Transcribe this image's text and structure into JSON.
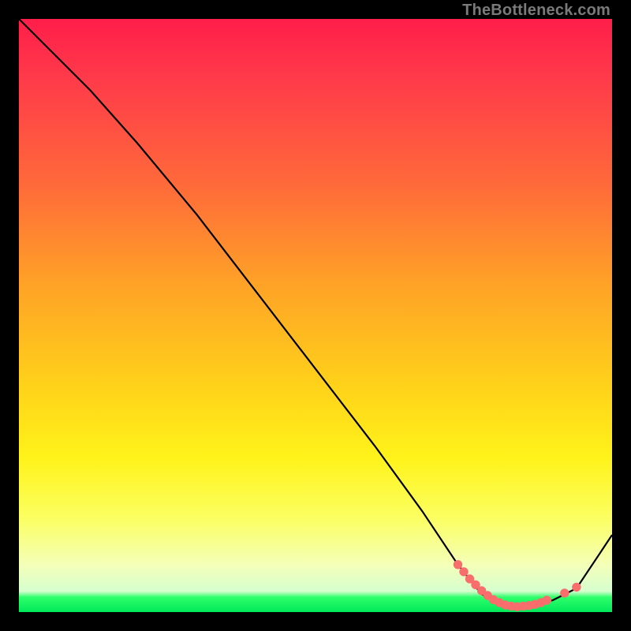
{
  "attribution": "TheBottleneck.com",
  "colors": {
    "curve_stroke": "#000000",
    "dot_fill": "#f96d6d",
    "dot_stroke": "#f96d6d"
  },
  "chart_data": {
    "type": "line",
    "title": "",
    "xlabel": "",
    "ylabel": "",
    "xlim": [
      0,
      100
    ],
    "ylim": [
      0,
      100
    ],
    "series": [
      {
        "name": "curve",
        "x": [
          0,
          6,
          12,
          20,
          30,
          40,
          50,
          60,
          68,
          74,
          78,
          82,
          86,
          90,
          94,
          98,
          100
        ],
        "y": [
          100,
          94,
          88,
          79,
          67,
          54,
          41,
          28,
          17,
          8,
          3,
          1,
          1,
          2,
          4,
          10,
          13
        ]
      }
    ],
    "highlight_dots": {
      "x": [
        74,
        75,
        76,
        77,
        78,
        79,
        80,
        81,
        82,
        83,
        84,
        85,
        86,
        87,
        88,
        89,
        92,
        94
      ],
      "y": [
        8,
        6.8,
        5.6,
        4.6,
        3.6,
        2.8,
        2.1,
        1.6,
        1.2,
        1.0,
        0.9,
        1.0,
        1.1,
        1.3,
        1.6,
        2.0,
        3.2,
        4.2
      ]
    }
  }
}
